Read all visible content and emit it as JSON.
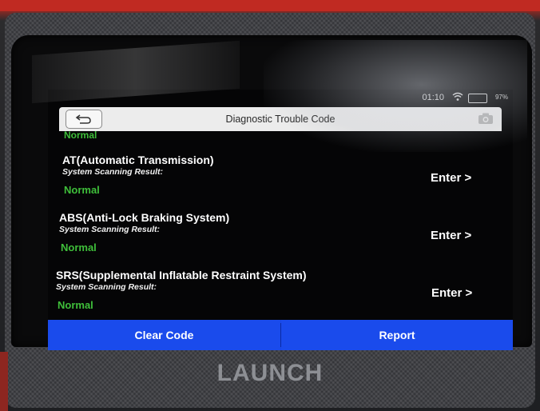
{
  "status_bar": {
    "time": "01:10",
    "battery": "97%"
  },
  "header": {
    "title": "Diagnostic Trouble Code"
  },
  "list": {
    "partial_status": "Normal",
    "items": [
      {
        "title": "AT(Automatic Transmission)",
        "subtitle": "System Scanning Result:",
        "status": "Normal",
        "action": "Enter >"
      },
      {
        "title": "ABS(Anti-Lock Braking System)",
        "subtitle": "System Scanning Result:",
        "status": "Normal",
        "action": "Enter >"
      },
      {
        "title": "SRS(Supplemental Inflatable Restraint System)",
        "subtitle": "System Scanning Result:",
        "status": "Normal",
        "action": "Enter >"
      }
    ]
  },
  "bottom_bar": {
    "clear_code": "Clear Code",
    "report": "Report"
  },
  "device": {
    "brand": "LAUNCH"
  },
  "colors": {
    "status_green": "#3fbf3a",
    "button_blue": "#1a4bec",
    "header_bg": "#ececec"
  },
  "icons": [
    "back-arrow-icon",
    "wifi-icon",
    "battery-icon",
    "camera-icon"
  ]
}
